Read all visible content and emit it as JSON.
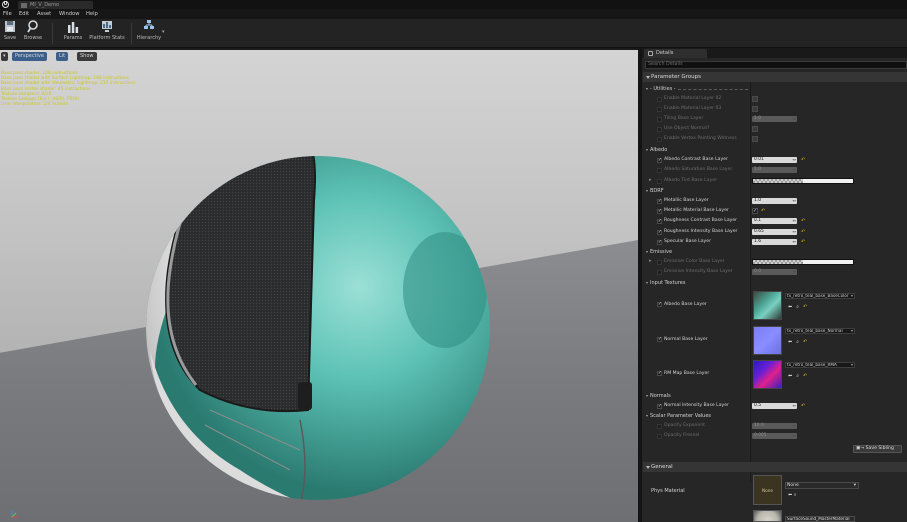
{
  "window": {
    "tab_title": "MI_V_Demo"
  },
  "menu": [
    "File",
    "Edit",
    "Asset",
    "Window",
    "Help"
  ],
  "toolbar": {
    "save": "Save",
    "browse": "Browse",
    "params": "Params",
    "platform_stats": "Platform Stats",
    "hierarchy": "Hierarchy"
  },
  "viewport": {
    "perspective": "Perspective",
    "lit": "Lit",
    "show": "Show",
    "stats": [
      "Base pass shader: 108 instructions",
      "Base pass shader with Surface Lightmap: 168 instructions",
      "Base pass shader with Volumetric Lightmap: 215 instructions",
      "Base pass vertex shader: 45 instructions",
      "Texture samplers: 8/16",
      "Texture Lookups (Est.): VS(0), PS(8)",
      "User interpolators: 2/4 Scalars"
    ]
  },
  "details": {
    "tab": "Details",
    "search_placeholder": "Search Details",
    "parameter_groups": "Parameter Groups",
    "groups": {
      "utilities": "- Utilities -",
      "albedo": "Albedo",
      "bdrf": "BDRF",
      "emissive": "Emissive",
      "input_textures": "Input Textures",
      "normals": "Normals",
      "scalar_parameter_values": "Scalar Parameter Values"
    },
    "params": {
      "enable_layer_02": "Enable Material Layer 02",
      "enable_layer_03": "Enable Material Layer 03",
      "tiling_base": "Tiling Base Layer",
      "tiling_base_val": "1.0",
      "use_object_normal": "Use Object Normal?",
      "enable_vertex_painting": "Enable Vertex Painting Wetness",
      "albedo_contrast": "Albedo Contrast Base Layer",
      "albedo_contrast_val": "0.01",
      "albedo_saturation": "Albedo Saturation Base Layer",
      "albedo_saturation_val": "1.0",
      "albedo_tint": "Albedo Tint Base Layer",
      "metallic": "Metallic Base Layer",
      "metallic_val": "1.0",
      "metallic_material": "Metallic Material Base Layer",
      "roughness_contrast": "Roughness Contrast Base Layer",
      "roughness_contrast_val": "0.1",
      "roughness_intensity": "Roughness Intensity Base Layer",
      "roughness_intensity_val": "0.65",
      "specular": "Specular Base Layer",
      "specular_val": "1.6",
      "emissive_color": "Emissive Color Base Layer",
      "emissive_intensity": "Emissive Intensity Base Layer",
      "emissive_intensity_val": "0.0",
      "albedo_tex": "Albedo Base Layer",
      "albedo_tex_name": "tx_retro_teal_base_BaseColor",
      "normal_tex": "Normal Base Layer",
      "normal_tex_name": "tx_retro_teal_base_Normal",
      "rm_tex": "RM Map Base Layer",
      "rm_tex_name": "tx_retro_teal_base_RMA",
      "normal_intensity": "Normal Intensity Base Layer",
      "normal_intensity_val": "0.5",
      "opacity_exponent": "Opacity Exponent",
      "opacity_exponent_val": "10.0",
      "opacity_fresnel": "Opacity Fresnel",
      "opacity_fresnel_val": "0.005"
    },
    "save_sibling": "Save Sibling",
    "general": "General",
    "phys_material": "Phys Material",
    "phys_none": "None",
    "phys_value": "None",
    "phys_next": "SurfaceSound_MasterMaterial"
  }
}
